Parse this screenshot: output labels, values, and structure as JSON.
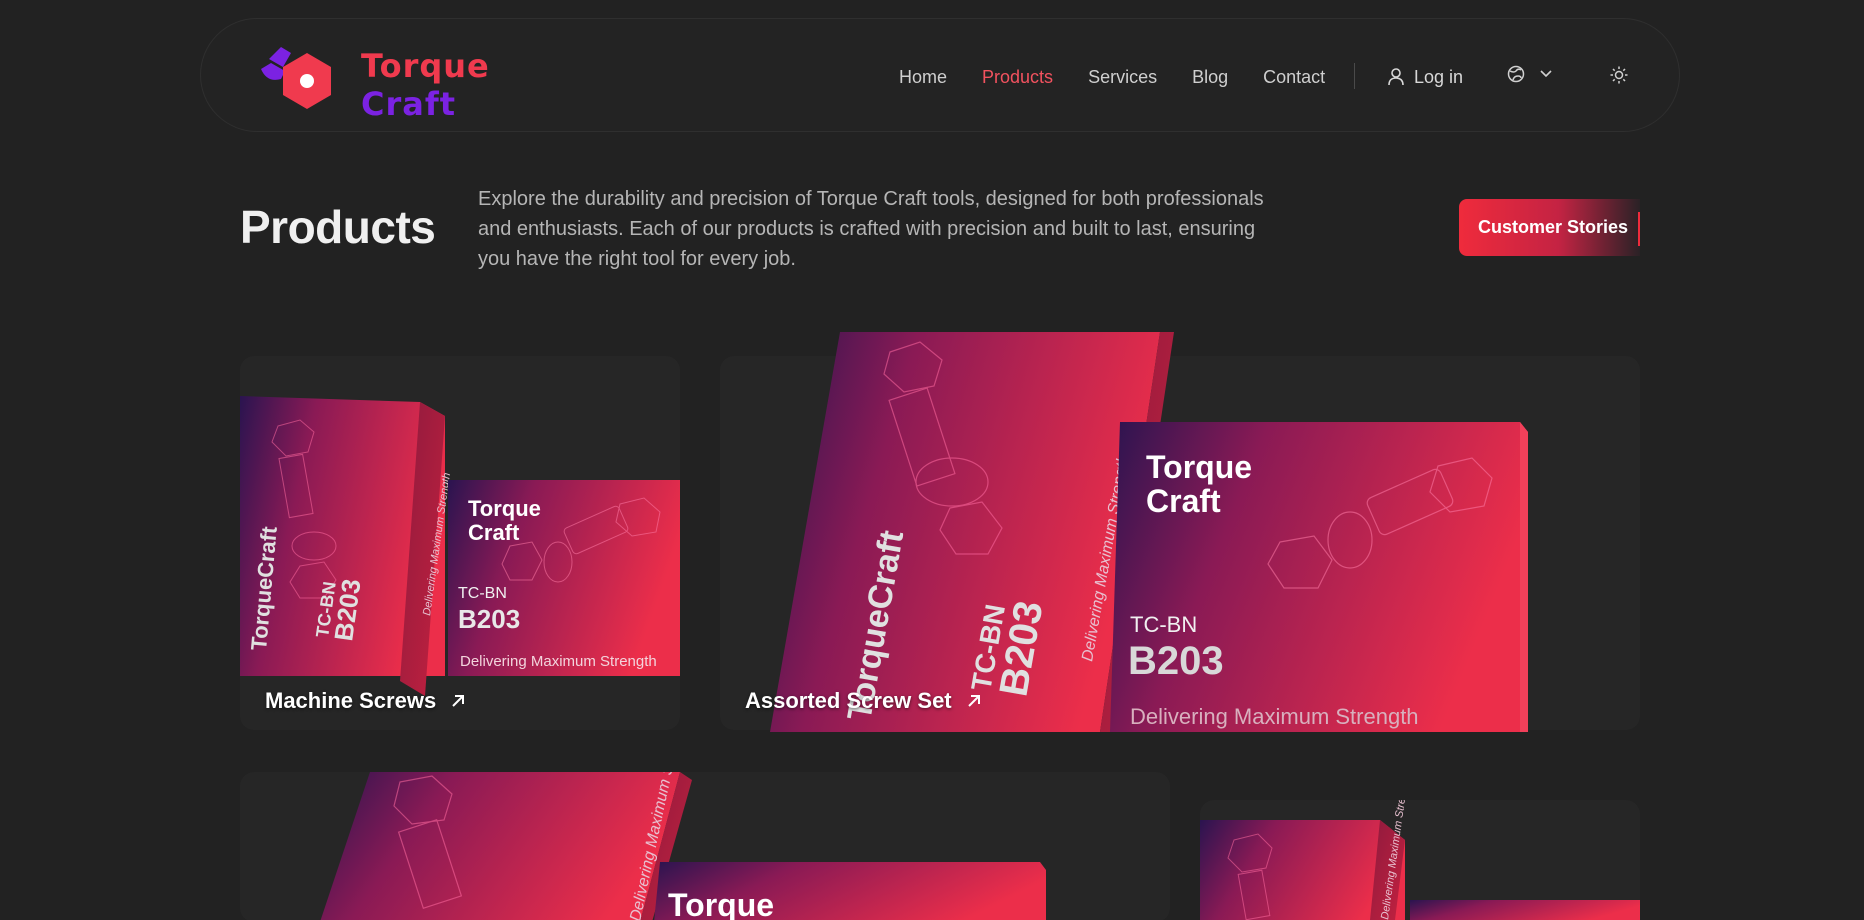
{
  "brand": {
    "line1": "Torque",
    "line2": "Craft"
  },
  "nav": {
    "links": [
      {
        "label": "Home",
        "active": false
      },
      {
        "label": "Products",
        "active": true
      },
      {
        "label": "Services",
        "active": false
      },
      {
        "label": "Blog",
        "active": false
      },
      {
        "label": "Contact",
        "active": false
      }
    ],
    "login_label": "Log in",
    "icons": {
      "login": "user-icon",
      "language": "globe-icon",
      "language_caret": "chevron-down-icon",
      "theme": "sun-icon"
    }
  },
  "header": {
    "title": "Products",
    "intro": "Explore the durability and precision of Torque Craft tools, designed for both professionals and enthusiasts. Each of our products is crafted with precision and built to last, ensuring you have the right tool for every job.",
    "cta_label": "Customer Stories"
  },
  "products": [
    {
      "name": "Machine Screws"
    },
    {
      "name": "Assorted Screw Set"
    }
  ],
  "box_art": {
    "brand_line1": "Torque",
    "brand_line2": "Craft",
    "side_brand": "TorqueCraft",
    "code": "TC-BN",
    "model": "B203",
    "tagline": "Delivering Maximum Strength",
    "spine": "Delivering Maximum Strength"
  },
  "colors": {
    "accent": "#f2525f",
    "brand_red": "#f03a4e",
    "brand_purple": "#7b22e2",
    "background": "#222222"
  }
}
